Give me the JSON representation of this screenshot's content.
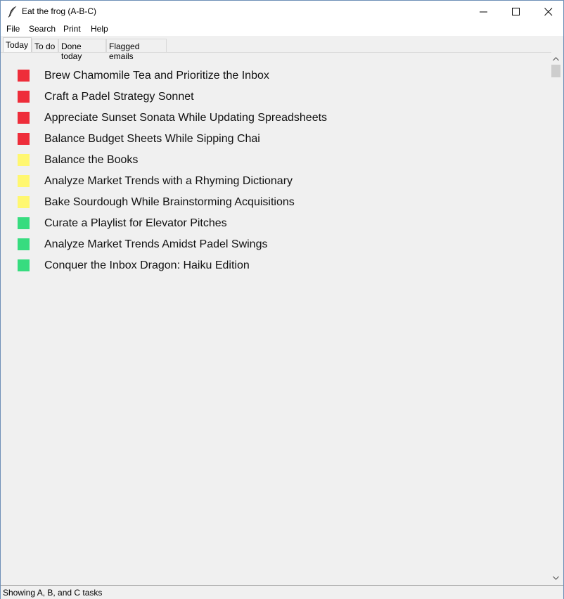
{
  "window": {
    "title": "Eat the frog (A-B-C)"
  },
  "menu": [
    "File",
    "Search",
    "Print",
    "Help"
  ],
  "tabs": [
    {
      "label": "Today",
      "active": true
    },
    {
      "label": "To do",
      "active": false
    },
    {
      "label": "Done today",
      "active": false
    },
    {
      "label": "Flagged emails",
      "active": false
    }
  ],
  "colors": {
    "priority_a": "#ee2d3a",
    "priority_b": "#fff770",
    "priority_c": "#37dc7f"
  },
  "tasks": [
    {
      "label": "Brew Chamomile Tea and Prioritize the Inbox",
      "priority": "A",
      "color": "#ee2d3a"
    },
    {
      "label": "Craft a Padel Strategy Sonnet",
      "priority": "A",
      "color": "#ee2d3a"
    },
    {
      "label": "Appreciate Sunset Sonata While Updating Spreadsheets",
      "priority": "A",
      "color": "#ee2d3a"
    },
    {
      "label": "Balance Budget Sheets While Sipping Chai",
      "priority": "A",
      "color": "#ee2d3a"
    },
    {
      "label": "Balance the Books",
      "priority": "B",
      "color": "#fff770"
    },
    {
      "label": "Analyze Market Trends with a Rhyming Dictionary",
      "priority": "B",
      "color": "#fff770"
    },
    {
      "label": "Bake Sourdough While Brainstorming Acquisitions",
      "priority": "B",
      "color": "#fff770"
    },
    {
      "label": "Curate a Playlist for Elevator Pitches",
      "priority": "C",
      "color": "#37dc7f"
    },
    {
      "label": "Analyze Market Trends Amidst Padel Swings",
      "priority": "C",
      "color": "#37dc7f"
    },
    {
      "label": "Conquer the Inbox Dragon: Haiku Edition",
      "priority": "C",
      "color": "#37dc7f"
    }
  ],
  "status": {
    "text": "Showing A, B, and C tasks"
  }
}
